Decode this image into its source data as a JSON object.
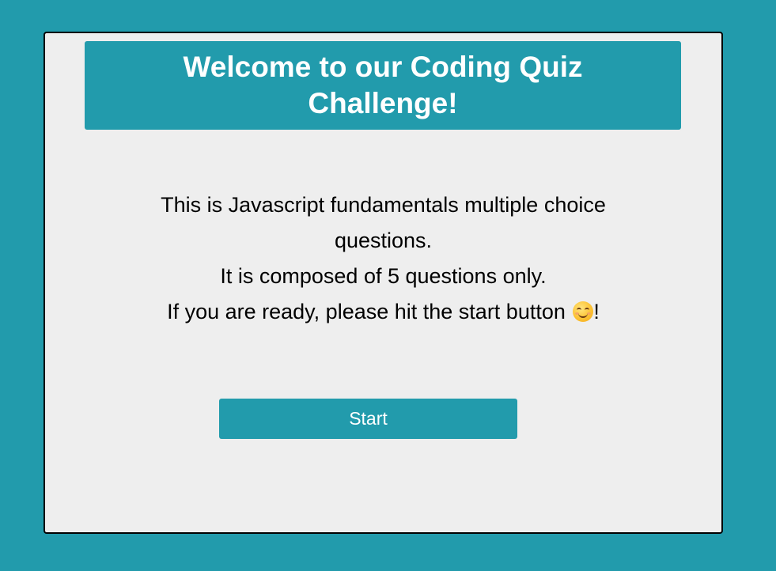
{
  "header": {
    "title": "Welcome to our Coding Quiz Challenge!"
  },
  "intro": {
    "line1": "This is Javascript fundamentals multiple choice questions.",
    "line2": "It is composed of 5 questions only.",
    "line3_prefix": "If you are ready, please hit the start button ",
    "line3_suffix": "!",
    "emoji_icon": "smiling-face-icon"
  },
  "start_button": {
    "label": "Start"
  },
  "colors": {
    "accent": "#229bac",
    "card_background": "#eeeeee",
    "card_border": "#000000",
    "text": "#000000",
    "button_text": "#ffffff"
  }
}
